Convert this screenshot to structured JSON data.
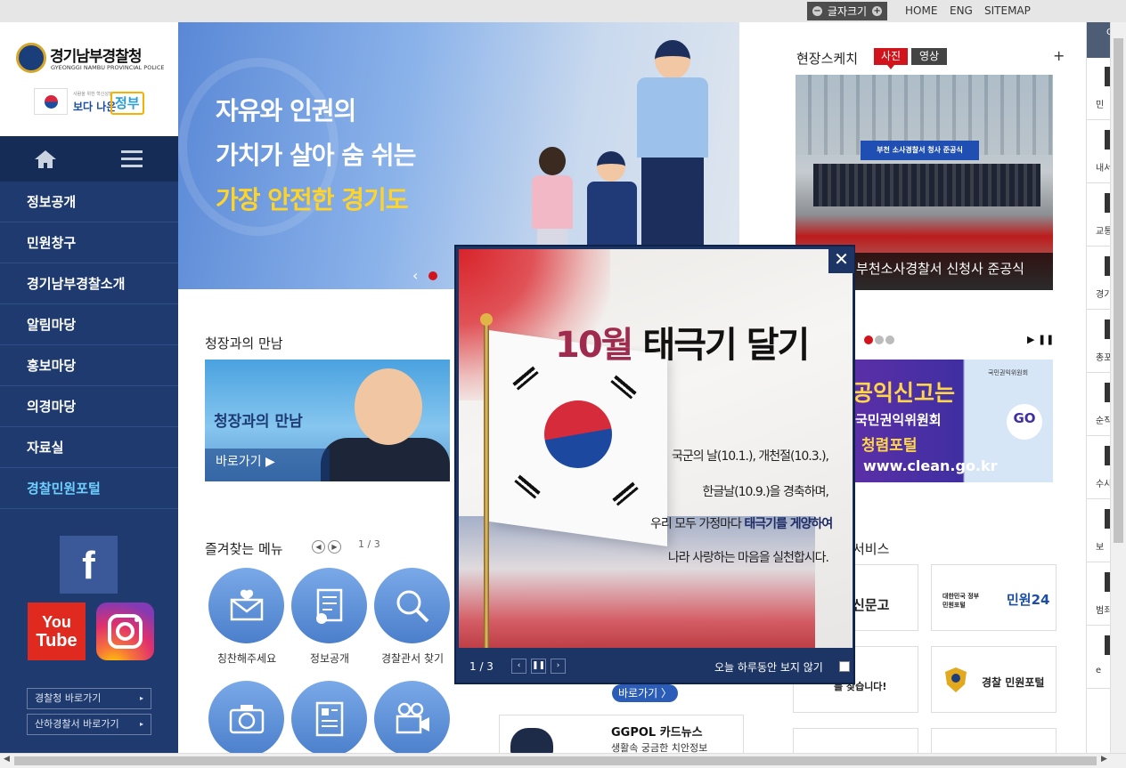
{
  "topbar": {
    "fontsize_label": "글자크기",
    "minus": "−",
    "plus": "+",
    "links": [
      "HOME",
      "ENG",
      "SITEMAP"
    ]
  },
  "sidebar": {
    "org_name": "경기남부경찰청",
    "org_english": "GYEONGGI NAMBU PROVINCIAL POLICE",
    "gov_small": "사람을 위한 혁신성장",
    "gov_text": "보다 나은",
    "gov_text2": "정부",
    "nav": [
      "정보공개",
      "민원창구",
      "경기남부경찰소개",
      "알림마당",
      "홍보마당",
      "의경마당",
      "자료실",
      "경찰민원포털"
    ],
    "sns": {
      "facebook": "f",
      "youtube_1": "You",
      "youtube_2": "Tube"
    },
    "goto": [
      "경찰청 바로가기",
      "산하경찰서 바로가기"
    ],
    "goto_arrow": "▸"
  },
  "hero": {
    "line1": "자유와 인권의",
    "line2": "가치가 살아 숨 쉬는",
    "line3": "가장 안전한 경기도",
    "prev": "‹"
  },
  "sketch": {
    "title": "현장스케치",
    "tab_photo": "사진",
    "tab_video": "영상",
    "more": "+",
    "banner": "부천 소사경찰서 청사 준공식",
    "caption": "부천소사경찰서 신청사 준공식"
  },
  "meet": {
    "title": "청장과의 만남",
    "banner_title": "청장과의 만남",
    "button": "바로가기 ▶"
  },
  "favorites": {
    "title": "즐겨찾는 메뉴",
    "prev": "◀",
    "next": "▶",
    "page": "1 / 3",
    "items": [
      "칭찬해주세요",
      "정보공개",
      "경찰관서 찾기"
    ]
  },
  "center": {
    "goto_button": "바로가기 〉",
    "card_title": "GGPOL 카드뉴스",
    "card_sub": "생활속 궁금한 치안정보"
  },
  "right": {
    "controls": "▶ ❚❚",
    "clean": {
      "org": "국민권익위원회",
      "l1": "공익신고는",
      "l2": "국민권익위원회",
      "l3": "청렴포털",
      "l4": "www.clean.go.kr",
      "go": "GO"
    },
    "services_title": "서비스",
    "svc1": "신문고",
    "svc2": "민원24",
    "svc2_sub": "대한민국 정부민원포털",
    "svc3": "를 찾습니다!",
    "svc4": "경찰 민원포털"
  },
  "quick": {
    "head": "Q",
    "items": [
      "민",
      "내서",
      "교통",
      "경기남\n용인",
      "총포",
      "순직",
      "수사",
      "보",
      "범죄\n발",
      "e"
    ]
  },
  "popup": {
    "title_num": "10월",
    "title_rest": " 태극기 달기",
    "line1": "국군의 날(10.1.), 개천절(10.3.),",
    "line2": "한글날(10.9.)을 경축하며,",
    "line3_pre": "우리 모두 가정마다 ",
    "line3_bold": "태극기를 게양하여",
    "line4": "나라 사랑하는 마음을 실천합시다.",
    "close": "✕",
    "count": "1 / 3",
    "prev": "‹",
    "pause": "❚❚",
    "next": "›",
    "no_today": "오늘 하루동안 보지 않기"
  }
}
